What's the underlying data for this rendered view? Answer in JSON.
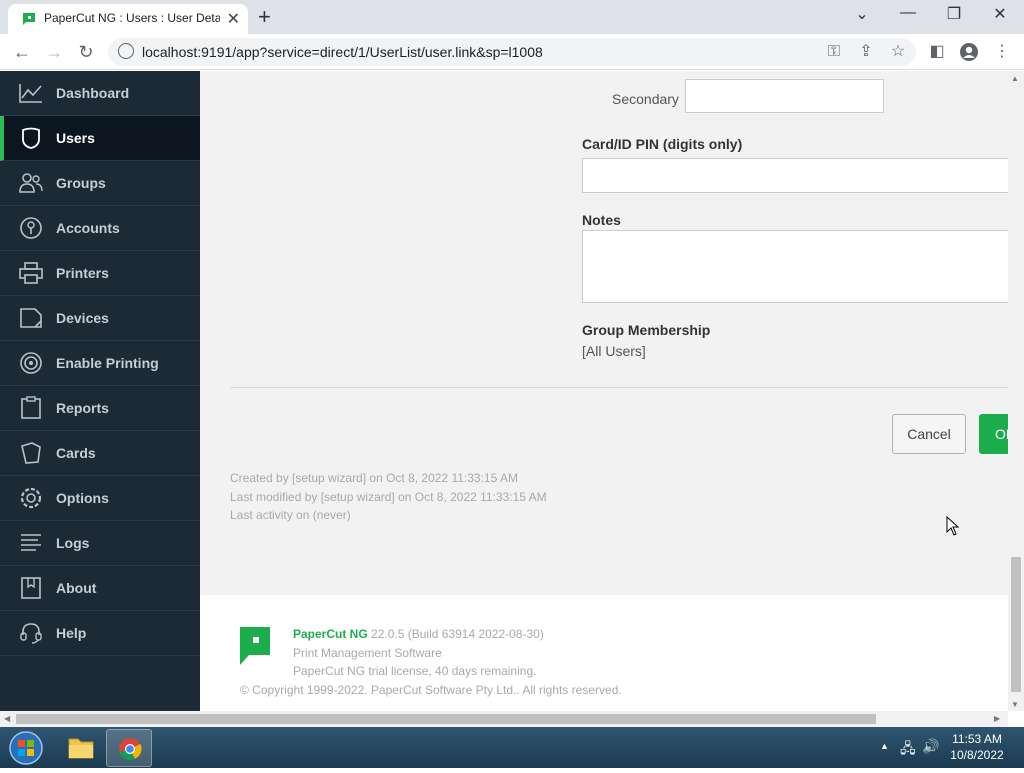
{
  "browser": {
    "tab_title": "PaperCut NG : Users : User Detail",
    "url": "localhost:9191/app?service=direct/1/UserList/user.link&sp=l1008"
  },
  "sidebar": {
    "items": [
      {
        "label": "Dashboard",
        "icon": "chart-line-icon"
      },
      {
        "label": "Users",
        "icon": "user-shield-icon",
        "active": true
      },
      {
        "label": "Groups",
        "icon": "group-icon"
      },
      {
        "label": "Accounts",
        "icon": "account-icon"
      },
      {
        "label": "Printers",
        "icon": "printer-icon"
      },
      {
        "label": "Devices",
        "icon": "device-icon"
      },
      {
        "label": "Enable Printing",
        "icon": "enable-printing-icon"
      },
      {
        "label": "Reports",
        "icon": "clipboard-icon"
      },
      {
        "label": "Cards",
        "icon": "card-icon"
      },
      {
        "label": "Options",
        "icon": "gear-icon"
      },
      {
        "label": "Logs",
        "icon": "list-lines-icon"
      },
      {
        "label": "About",
        "icon": "book-icon"
      },
      {
        "label": "Help",
        "icon": "headset-icon"
      }
    ]
  },
  "form": {
    "secondary_label": "Secondary",
    "secondary_value": "",
    "pin_label": "Card/ID PIN (digits only)",
    "pin_value": "",
    "notes_label": "Notes",
    "notes_value": "",
    "group_label": "Group Membership",
    "group_value": "[All Users]",
    "cancel_label": "Cancel",
    "ok_label": "OK"
  },
  "meta": {
    "created": "Created by [setup wizard] on Oct 8, 2022 11:33:15 AM",
    "modified": "Last modified by [setup wizard] on Oct 8, 2022 11:33:15 AM",
    "activity": "Last activity on (never)"
  },
  "footer": {
    "product": "PaperCut NG",
    "version": "22.0.5 (Build 63914 2022-08-30)",
    "subtitle": "Print Management Software",
    "license": "PaperCut NG trial license, 40 days remaining.",
    "copyright": "© Copyright 1999-2022. PaperCut Software Pty Ltd.. All rights reserved."
  },
  "taskbar": {
    "time": "11:53 AM",
    "date": "10/8/2022"
  },
  "colors": {
    "sidebar_bg": "#1c2a36",
    "accent_green": "#1cae4d"
  }
}
